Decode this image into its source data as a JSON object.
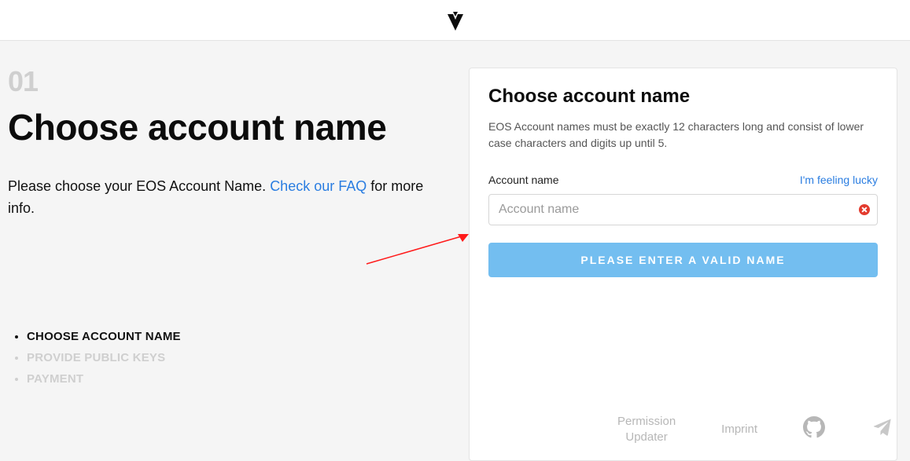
{
  "step_number": "01",
  "heading": "Choose account name",
  "sub_before": "Please choose your EOS Account Name. ",
  "sub_link": "Check our FAQ",
  "sub_after": " for more info.",
  "steps": {
    "choose": "CHOOSE ACCOUNT NAME",
    "keys": "PROVIDE PUBLIC KEYS",
    "payment": "PAYMENT"
  },
  "card": {
    "title": "Choose account name",
    "desc": "EOS Account names must be exactly 12 characters long and consist of lower case characters and digits up until 5.",
    "field_label": "Account name",
    "lucky": "I'm feeling lucky",
    "placeholder": "Account name",
    "button": "PLEASE ENTER A VALID NAME"
  },
  "footer": {
    "perm": "Permission Updater",
    "imprint": "Imprint"
  }
}
